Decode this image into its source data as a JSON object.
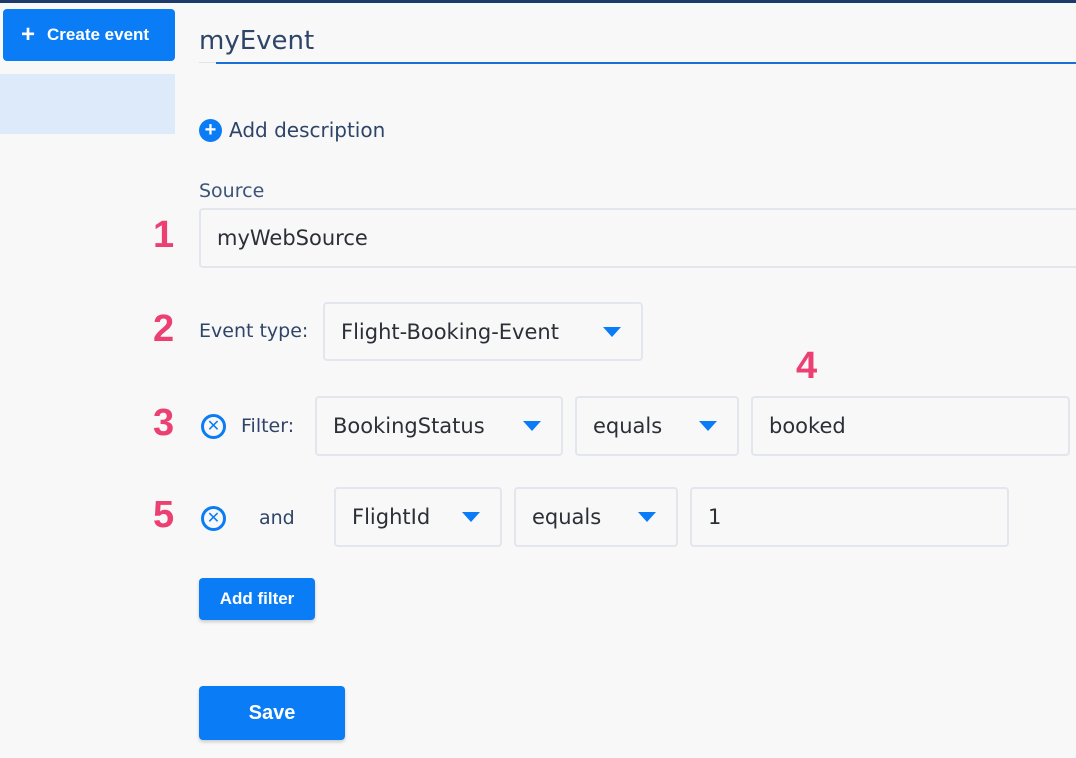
{
  "sidebar": {
    "create_button": {
      "icon": "plus-icon",
      "label": "Create event"
    }
  },
  "event": {
    "title": "myEvent",
    "add_description_label": "Add description",
    "source_label": "Source",
    "source_value": "myWebSource",
    "event_type_label": "Event type:",
    "event_type_value": "Flight-Booking-Event"
  },
  "filters": [
    {
      "connector": "Filter:",
      "field": "BookingStatus",
      "operator": "equals",
      "value": "booked"
    },
    {
      "connector": "and",
      "field": "FlightId",
      "operator": "equals",
      "value": "1"
    }
  ],
  "actions": {
    "add_filter_label": "Add filter",
    "save_label": "Save"
  },
  "annotations": [
    "1",
    "2",
    "3",
    "4",
    "5"
  ],
  "colors": {
    "accent": "#0a7cf5",
    "annotation": "#ec4073",
    "selected_sidebar": "#ddeafa"
  }
}
